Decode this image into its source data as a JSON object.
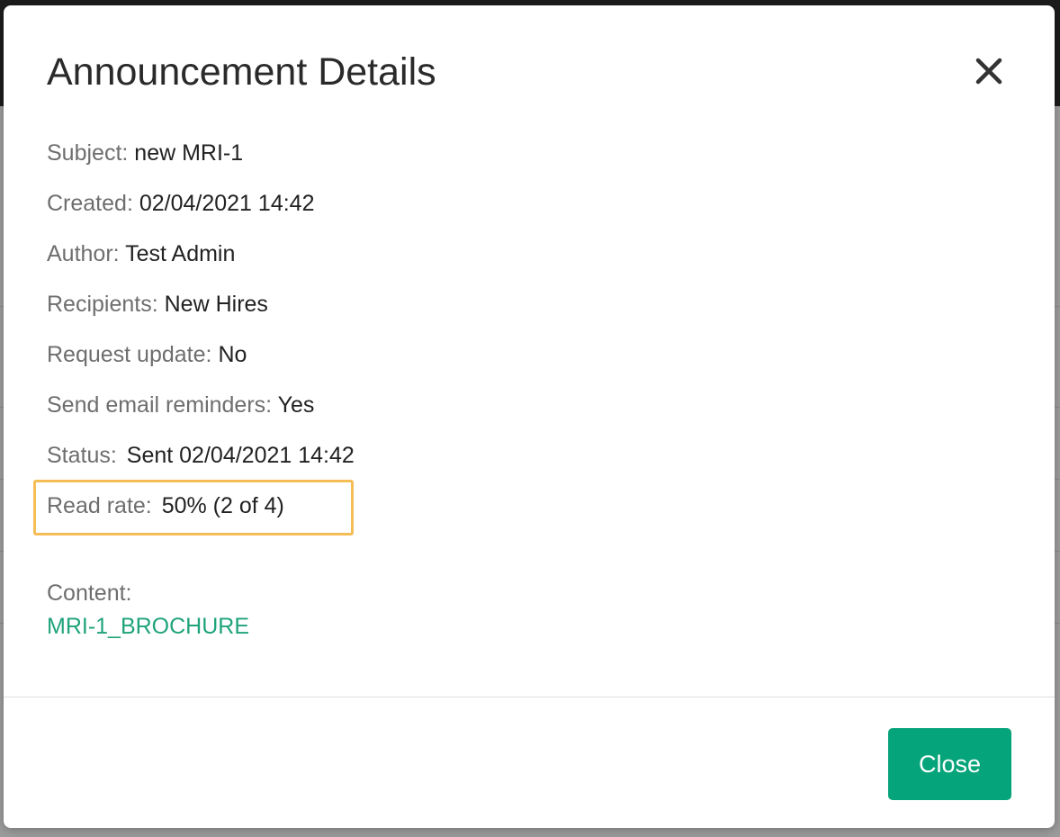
{
  "modal": {
    "title": "Announcement Details",
    "close_icon": "close-icon",
    "fields": {
      "subject": {
        "label": "Subject:",
        "value": "new MRI-1"
      },
      "created": {
        "label": "Created:",
        "value": "02/04/2021 14:42"
      },
      "author": {
        "label": "Author:",
        "value": "Test Admin"
      },
      "recipients": {
        "label": "Recipients:",
        "value": "New Hires"
      },
      "request_update": {
        "label": "Request update:",
        "value": "No"
      },
      "send_email_reminders": {
        "label": "Send email reminders:",
        "value": "Yes"
      },
      "status": {
        "label": "Status:",
        "value": "Sent 02/04/2021 14:42"
      },
      "read_rate": {
        "label": "Read rate:",
        "value": "50% (2 of 4)"
      }
    },
    "content": {
      "label": "Content:",
      "link_text": "MRI-1_BROCHURE"
    },
    "footer": {
      "close_label": "Close"
    }
  },
  "colors": {
    "accent_button": "#06a47a",
    "link": "#1fa37b",
    "highlight": "#f6bd56"
  }
}
